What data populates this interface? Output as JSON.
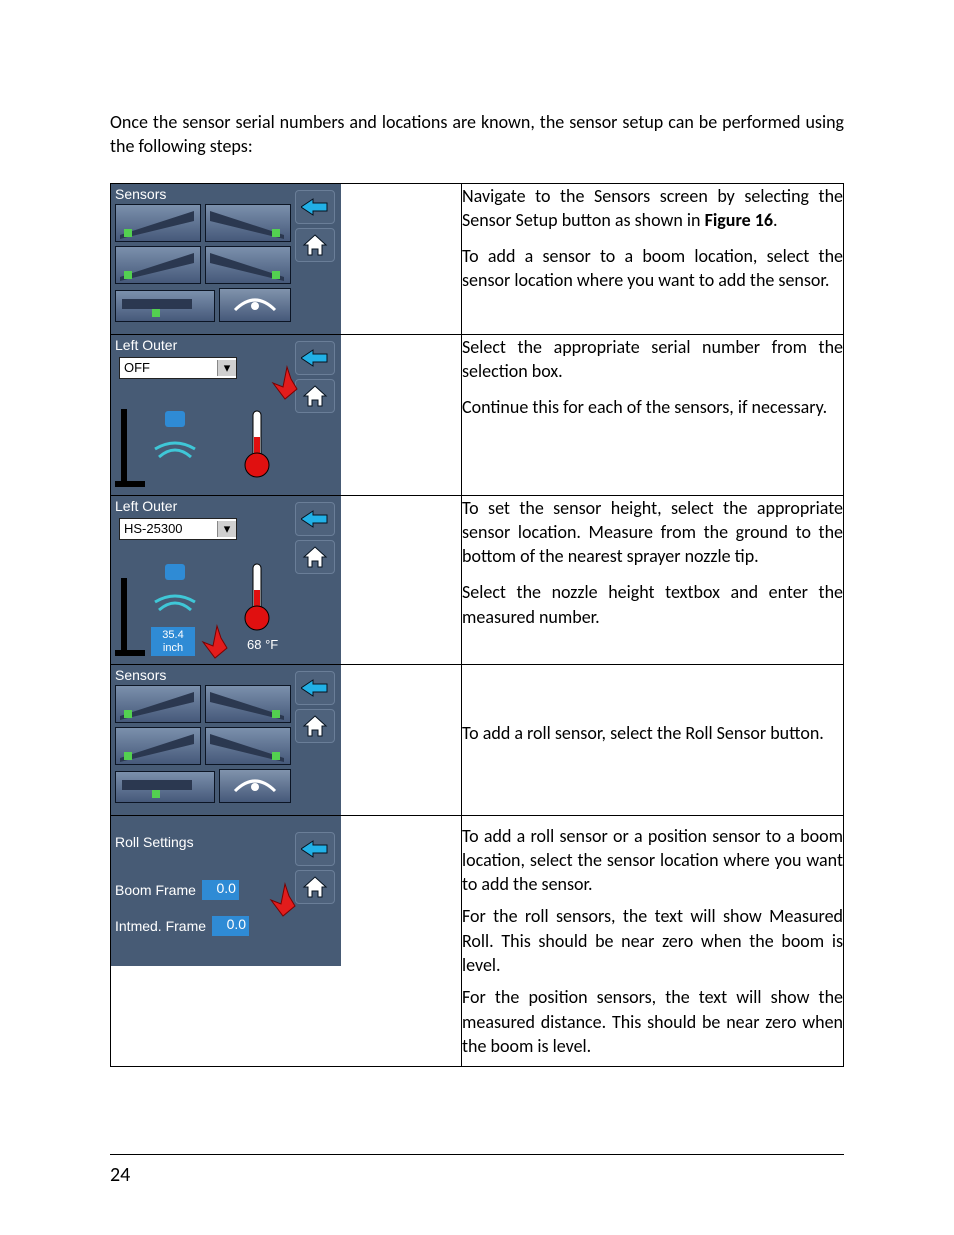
{
  "intro": "Once the sensor serial numbers and locations are known, the sensor setup can be performed using the following steps:",
  "page_number": "24",
  "figure_ref": "Figure 16",
  "rows": [
    {
      "panel": {
        "type": "sensors",
        "title": "Sensors"
      },
      "text": [
        "Navigate to the Sensors screen by selecting the Sensor Setup button as shown in ",
        "To add a sensor to a boom location, select the sensor location where you want to add the sensor."
      ]
    },
    {
      "panel": {
        "type": "left-outer",
        "title": "Left Outer",
        "select_value": "OFF"
      },
      "text": [
        "Select the appropriate serial number from the selection box.",
        "Continue this for each of the sensors, if necessary."
      ]
    },
    {
      "panel": {
        "type": "left-outer-set",
        "title": "Left Outer",
        "select_value": "HS-25300",
        "height_value": "35.4",
        "height_unit": "inch",
        "temp_value": "68 °F"
      },
      "text": [
        "To set the sensor height, select the appropriate sensor location.  Measure from the ground to the bottom of the nearest sprayer nozzle tip.",
        "Select the nozzle height textbox and enter the measured number."
      ]
    },
    {
      "panel": {
        "type": "sensors",
        "title": "Sensors"
      },
      "text": [
        "To add a roll sensor, select the Roll Sensor button."
      ]
    },
    {
      "panel": {
        "type": "roll",
        "title": "Roll Settings",
        "rows": [
          {
            "label": "Boom Frame",
            "value": "0.0"
          },
          {
            "label": "Intmed. Frame",
            "value": "0.0"
          }
        ]
      },
      "text": [
        "To add a roll sensor or a position sensor to a boom location, select the sensor location where you want to add the sensor.",
        "For the roll sensors, the text will show Measured Roll.  This should be near zero when the boom is level.",
        "For the position sensors, the text will show the measured distance.  This should be near zero when the boom is level."
      ]
    }
  ]
}
